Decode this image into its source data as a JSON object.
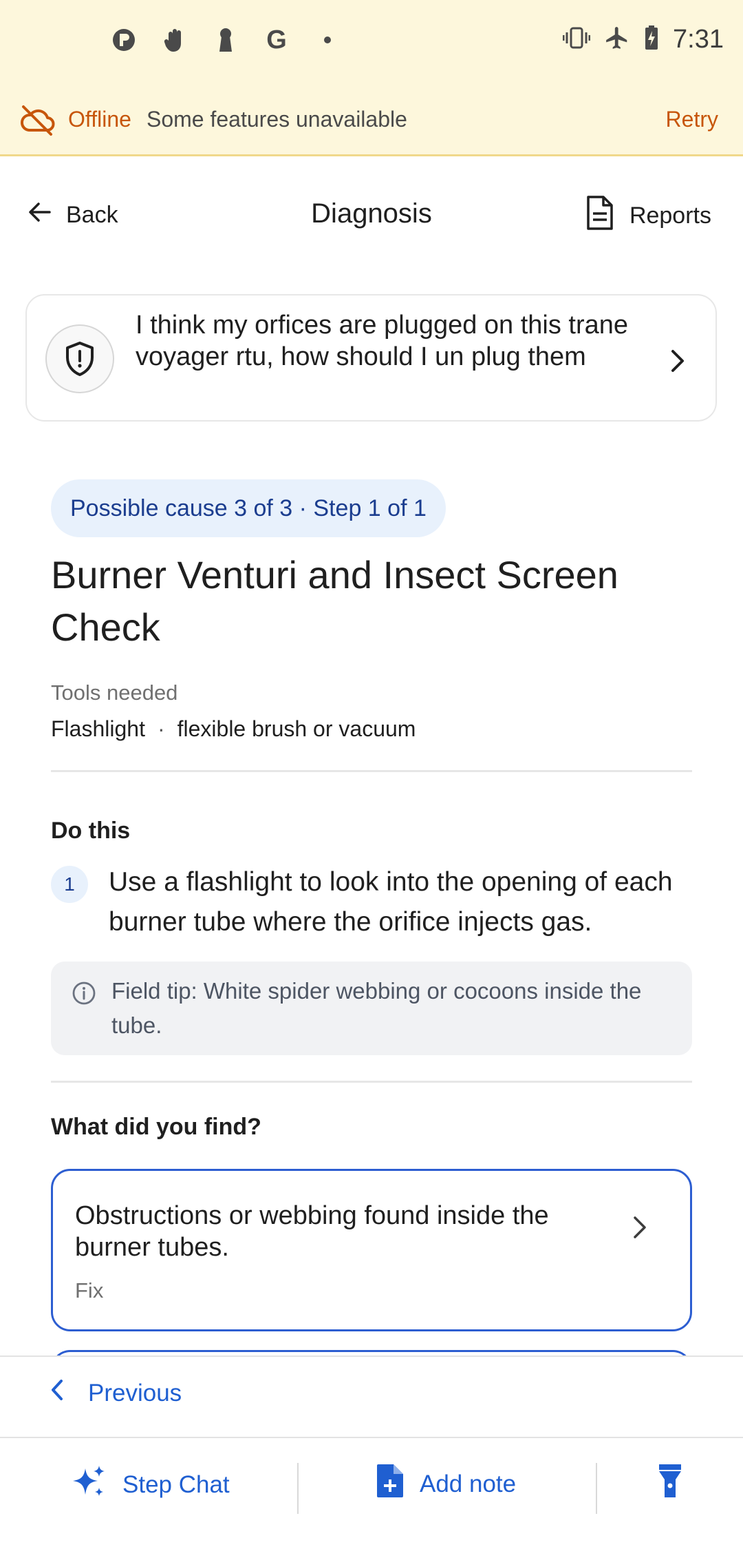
{
  "status_bar": {
    "time": "7:31",
    "left_icons": [
      "app-p-icon",
      "hand-icon",
      "keyhole-icon",
      "google-g-icon",
      "dot-icon"
    ],
    "right_icons": [
      "vibrate-icon",
      "airplane-icon",
      "battery-charging-icon"
    ],
    "google_letter": "G"
  },
  "offline_banner": {
    "label": "Offline",
    "message": "Some features unavailable",
    "retry": "Retry",
    "color": "#c7560b"
  },
  "nav": {
    "back": "Back",
    "title": "Diagnosis",
    "reports": "Reports"
  },
  "question": {
    "text": "I think my orfices are plugged on this trane voyager rtu, how should I un plug them"
  },
  "step": {
    "badge": "Possible cause 3 of 3 · Step 1 of 1",
    "title": "Burner Venturi and Insect Screen Check",
    "tools_label": "Tools needed",
    "tools": [
      "Flashlight",
      "flexible brush or vacuum"
    ],
    "tools_separator": "·",
    "do_this_label": "Do this",
    "instructions": [
      {
        "number": "1",
        "text": "Use a flashlight to look into the opening of each burner tube where the orifice injects gas."
      }
    ],
    "field_tip": "Field tip: White spider webbing or cocoons inside the tube."
  },
  "findings": {
    "label": "What did you find?",
    "options": [
      {
        "title": "Obstructions or webbing found inside the burner tubes.",
        "subtitle": "Fix"
      }
    ]
  },
  "footer": {
    "previous": "Previous",
    "step_chat": "Step Chat",
    "add_note": "Add note",
    "accent": "#1f5fd1"
  }
}
